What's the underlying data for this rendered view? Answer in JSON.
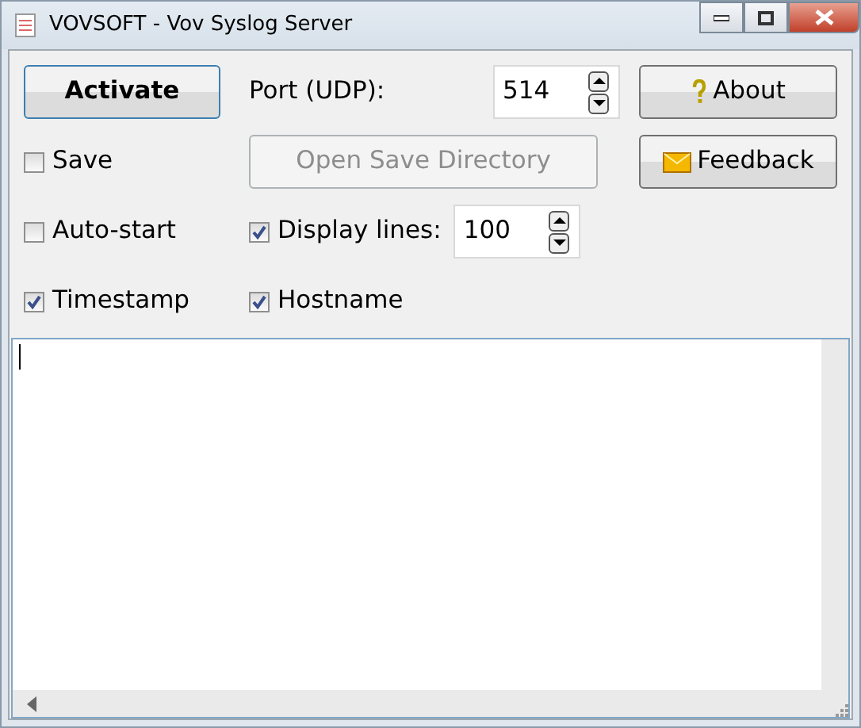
{
  "window": {
    "title": "VOVSOFT - Vov Syslog Server"
  },
  "activate_button": {
    "label": "Activate"
  },
  "port": {
    "label": "Port (UDP):",
    "value": "514"
  },
  "about_button": {
    "label": "About"
  },
  "save": {
    "label": "Save",
    "checked": false
  },
  "open_dir_button": {
    "label": "Open Save Directory",
    "disabled": true
  },
  "feedback_button": {
    "label": "Feedback"
  },
  "auto_start": {
    "label": "Auto-start",
    "checked": false
  },
  "display_lines": {
    "label": "Display lines:",
    "checked": true,
    "value": "100"
  },
  "timestamp": {
    "label": "Timestamp",
    "checked": true
  },
  "hostname": {
    "label": "Hostname",
    "checked": true
  }
}
